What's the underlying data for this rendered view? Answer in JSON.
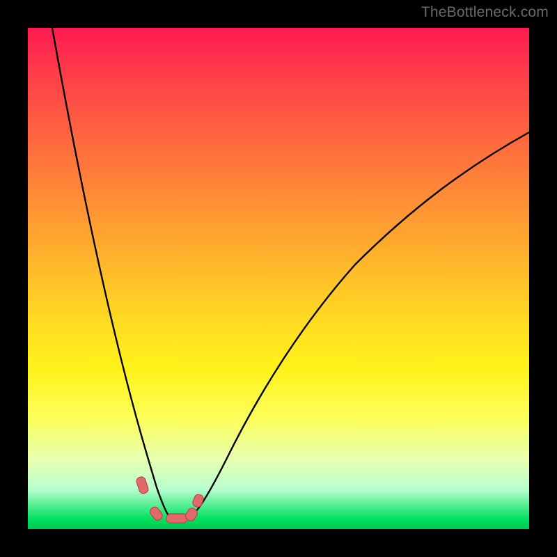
{
  "watermark": {
    "text": "TheBottleneck.com"
  },
  "colors": {
    "frame": "#000000",
    "curve": "#000000",
    "marker_fill": "#e06a6a",
    "marker_stroke": "#c04545",
    "gradient_stops": [
      "#ff1a52",
      "#ff3a4a",
      "#ff5a42",
      "#ff7a3a",
      "#ff9a32",
      "#ffba2a",
      "#ffda22",
      "#fff21a",
      "#fbff5a",
      "#e8ffb0",
      "#b8ffd0",
      "#00e060",
      "#00c850"
    ]
  },
  "chart_data": {
    "type": "line",
    "title": "",
    "xlabel": "",
    "ylabel": "",
    "xlim": [
      0,
      100
    ],
    "ylim": [
      0,
      100
    ],
    "grid": false,
    "series": [
      {
        "name": "left-branch",
        "x": [
          5,
          8,
          10,
          12,
          14,
          16,
          18,
          20,
          21,
          22,
          23,
          24,
          25,
          26,
          27,
          28
        ],
        "y": [
          100,
          88,
          78,
          68,
          58,
          48,
          38,
          28,
          22,
          18,
          14,
          10,
          7,
          5,
          4,
          3
        ]
      },
      {
        "name": "right-branch",
        "x": [
          32,
          34,
          36,
          38,
          41,
          45,
          50,
          56,
          63,
          70,
          78,
          86,
          94,
          100
        ],
        "y": [
          3,
          5,
          8,
          12,
          18,
          26,
          35,
          44,
          52,
          60,
          67,
          73,
          77,
          80
        ]
      }
    ],
    "markers": [
      {
        "name": "left-start",
        "x": 22.5,
        "y": 8.5
      },
      {
        "name": "left-end",
        "x": 25.0,
        "y": 3.2
      },
      {
        "name": "bottom",
        "x": 29.0,
        "y": 2.7
      },
      {
        "name": "right-start",
        "x": 32.5,
        "y": 4.0
      },
      {
        "name": "right-end",
        "x": 33.2,
        "y": 6.5
      }
    ],
    "legend": false
  }
}
